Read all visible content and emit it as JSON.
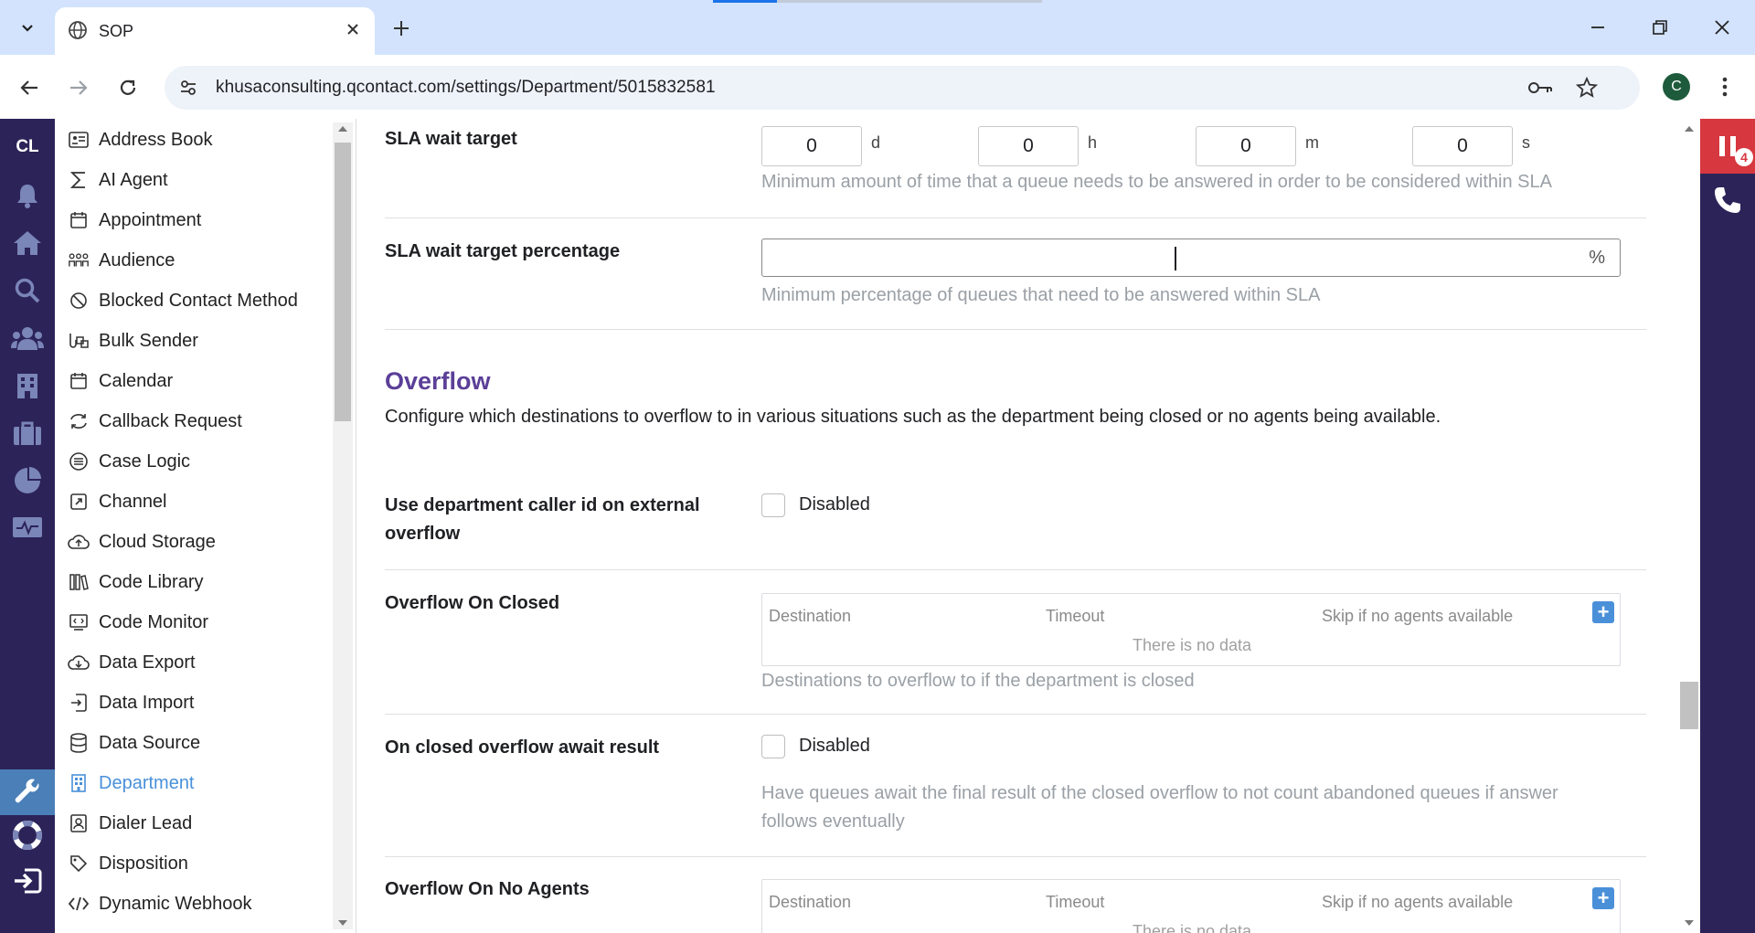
{
  "browser": {
    "tab_title": "SOP",
    "url": "khusaconsulting.qcontact.com/settings/Department/5015832581",
    "profile_initial": "C"
  },
  "rail": {
    "brand": "CL",
    "icons": [
      "bell-icon",
      "home-icon",
      "search-icon",
      "users-icon",
      "building-icon",
      "briefcase-icon",
      "pie-chart-icon",
      "monitor-icon",
      "wrench-icon",
      "lifebuoy-icon",
      "logout-icon"
    ],
    "active": "wrench-icon"
  },
  "sidebar": {
    "items": [
      {
        "label": "Address Book",
        "icon": "address-book-icon"
      },
      {
        "label": "AI Agent",
        "icon": "sigma-icon"
      },
      {
        "label": "Appointment",
        "icon": "calendar-icon"
      },
      {
        "label": "Audience",
        "icon": "audience-icon"
      },
      {
        "label": "Blocked Contact Method",
        "icon": "blocked-icon"
      },
      {
        "label": "Bulk Sender",
        "icon": "bulk-sender-icon"
      },
      {
        "label": "Calendar",
        "icon": "calendar-icon"
      },
      {
        "label": "Callback Request",
        "icon": "callback-icon"
      },
      {
        "label": "Case Logic",
        "icon": "case-logic-icon"
      },
      {
        "label": "Channel",
        "icon": "channel-icon"
      },
      {
        "label": "Cloud Storage",
        "icon": "cloud-upload-icon"
      },
      {
        "label": "Code Library",
        "icon": "library-icon"
      },
      {
        "label": "Code Monitor",
        "icon": "code-monitor-icon"
      },
      {
        "label": "Data Export",
        "icon": "cloud-download-icon"
      },
      {
        "label": "Data Import",
        "icon": "import-icon"
      },
      {
        "label": "Data Source",
        "icon": "database-icon"
      },
      {
        "label": "Department",
        "icon": "department-icon"
      },
      {
        "label": "Dialer Lead",
        "icon": "dialer-lead-icon"
      },
      {
        "label": "Disposition",
        "icon": "tag-icon"
      },
      {
        "label": "Dynamic Webhook",
        "icon": "code-icon"
      }
    ],
    "active": "Department"
  },
  "form": {
    "sla_wait_target": {
      "label": "SLA wait target",
      "days": "0",
      "days_unit": "d",
      "hours": "0",
      "hours_unit": "h",
      "minutes": "0",
      "minutes_unit": "m",
      "seconds": "0",
      "seconds_unit": "s",
      "help": "Minimum amount of time that a queue needs to be answered in order to be considered within SLA"
    },
    "sla_wait_target_percentage": {
      "label": "SLA wait target percentage",
      "value": "",
      "suffix": "%",
      "help": "Minimum percentage of queues that need to be answered within SLA"
    },
    "overflow": {
      "title": "Overflow",
      "description": "Configure which destinations to overflow to in various situations such as the department being closed or no agents being available."
    },
    "use_caller_id": {
      "label_line1": "Use department caller id on external",
      "label_line2": "overflow",
      "checkbox_label": "Disabled",
      "checked": false
    },
    "overflow_on_closed": {
      "label": "Overflow On Closed",
      "columns": [
        "Destination",
        "Timeout",
        "Skip if no agents available"
      ],
      "empty_text": "There is no data",
      "add_label": "+",
      "help": "Destinations to overflow to if the department is closed"
    },
    "on_closed_await": {
      "label": "On closed overflow await result",
      "checkbox_label": "Disabled",
      "checked": false,
      "help_line1": "Have queues await the final result of the closed overflow to not count abandoned queues if answer",
      "help_line2": "follows eventually"
    },
    "overflow_on_no_agents": {
      "label": "Overflow On No Agents",
      "columns": [
        "Destination",
        "Timeout",
        "Skip if no agents available"
      ],
      "empty_text": "There is no data",
      "add_label": "+"
    }
  },
  "right_rail": {
    "badge_count": "4"
  },
  "colors": {
    "rail_bg": "#2c2358",
    "accent": "#4a90d9",
    "section_title": "#5b3f98",
    "alert": "#d7373f"
  }
}
